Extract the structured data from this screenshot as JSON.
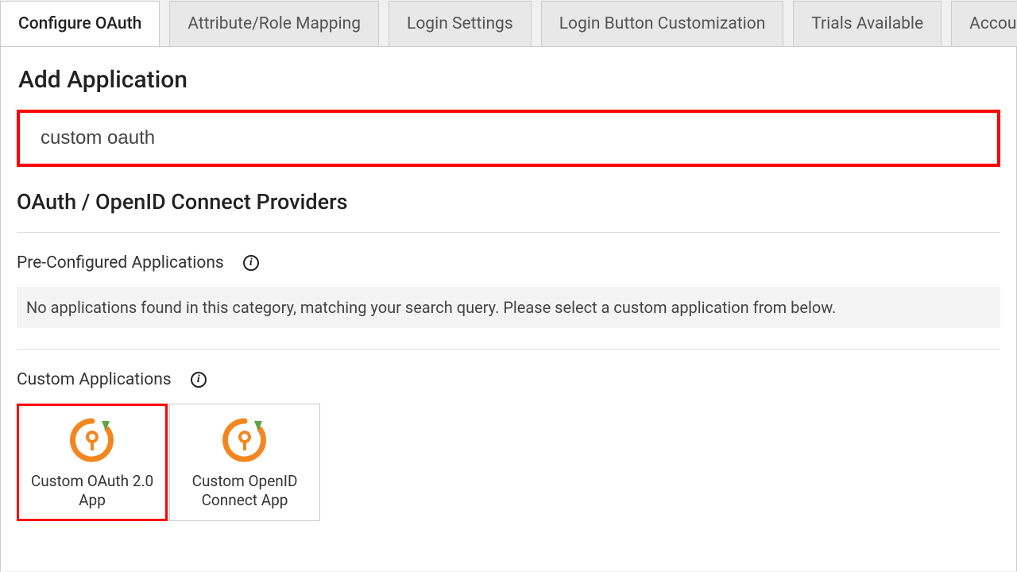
{
  "tabs": [
    {
      "label": "Configure OAuth",
      "active": true
    },
    {
      "label": "Attribute/Role Mapping",
      "active": false
    },
    {
      "label": "Login Settings",
      "active": false
    },
    {
      "label": "Login Button Customization",
      "active": false
    },
    {
      "label": "Trials Available",
      "active": false
    },
    {
      "label": "Account Setup",
      "active": false
    }
  ],
  "headings": {
    "add_application": "Add Application",
    "providers": "OAuth / OpenID Connect Providers",
    "preconfigured": "Pre-Configured Applications",
    "custom": "Custom Applications"
  },
  "search": {
    "value": "custom oauth"
  },
  "messages": {
    "no_preconfigured": "No applications found in this category, matching your search query. Please select a custom application from below."
  },
  "custom_apps": [
    {
      "label": "Custom OAuth 2.0 App",
      "selected": true
    },
    {
      "label": "Custom OpenID Connect App",
      "selected": false
    }
  ],
  "info_glyph": "i"
}
